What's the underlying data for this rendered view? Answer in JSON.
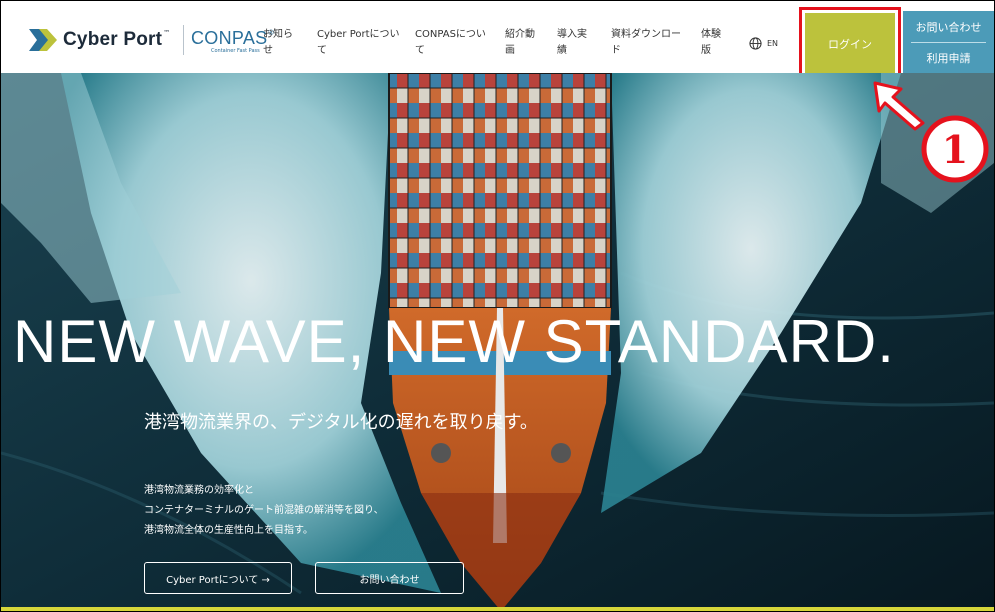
{
  "header": {
    "logo_text": "Cyber Port",
    "logo_tm": "™",
    "conpas_text": "CONPAS",
    "conpas_reg": "®",
    "conpas_sub": "Container Fast Pass",
    "nav": [
      {
        "line1": "お知ら",
        "line2": "せ"
      },
      {
        "line1": "Cyber Portについ",
        "line2": "て"
      },
      {
        "line1": "CONPASについ",
        "line2": "て"
      },
      {
        "line1": "紹介動",
        "line2": "画"
      },
      {
        "line1": "導入実",
        "line2": "績"
      },
      {
        "line1": "資料ダウンロー",
        "line2": "ド"
      },
      {
        "line1": "体験",
        "line2": "版"
      }
    ],
    "lang": "EN",
    "login": "ログイン",
    "contact": "お問い合わせ",
    "apply": "利用申請"
  },
  "hero": {
    "headline": "NEW  WAVE, NEW  STANDARD.",
    "subheadline": "港湾物流業界の、デジタル化の遅れを取り戻す。",
    "body": [
      "港湾物流業務の効率化と",
      "コンテナターミナルのゲート前混雑の解消等を図り、",
      "港湾物流全体の生産性向上を目指す。"
    ],
    "btn_about": "Cyber Portについて →",
    "btn_contact": "お問い合わせ"
  },
  "annotation": {
    "step": "①",
    "highlight_color": "#e5121d"
  },
  "colors": {
    "login_bg": "#bcc23c",
    "contact_bg": "#4c9bb8",
    "sea": "#0d2733"
  }
}
